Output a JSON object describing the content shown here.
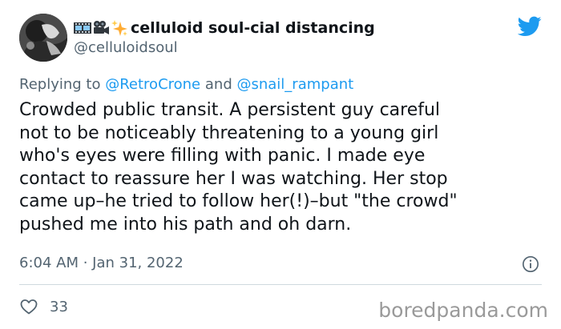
{
  "tweet": {
    "author": {
      "display_name": "celluloid soul-cial distancing",
      "handle": "@celluloidsoul",
      "name_emojis": [
        "film-frames-icon",
        "movie-camera-icon",
        "sparkles-icon"
      ]
    },
    "reply": {
      "prefix": "Replying to",
      "mention1": "@RetroCrone",
      "conjunction": "and",
      "mention2": "@snail_rampant"
    },
    "body_lines": [
      "Crowded public transit. A persistent guy careful",
      "not to be noticeably threatening to a young girl",
      "who's eyes were filling with panic. I made eye",
      "contact to reassure her I was watching. Her stop",
      "came up–he tried to follow her(!)–but \"the crowd\"",
      "pushed me into his path and oh darn."
    ],
    "timestamp": "6:04 AM · Jan 31, 2022",
    "like_count": "33",
    "icons": {
      "brand": "twitter-bird-icon",
      "info": "info-icon",
      "like": "heart-icon"
    }
  },
  "watermark": "boredpanda.com",
  "colors": {
    "text": "#0f1419",
    "secondary": "#536471",
    "accent": "#1d9bf0",
    "divider": "#cfd9de",
    "watermark": "#9a9a9a"
  }
}
